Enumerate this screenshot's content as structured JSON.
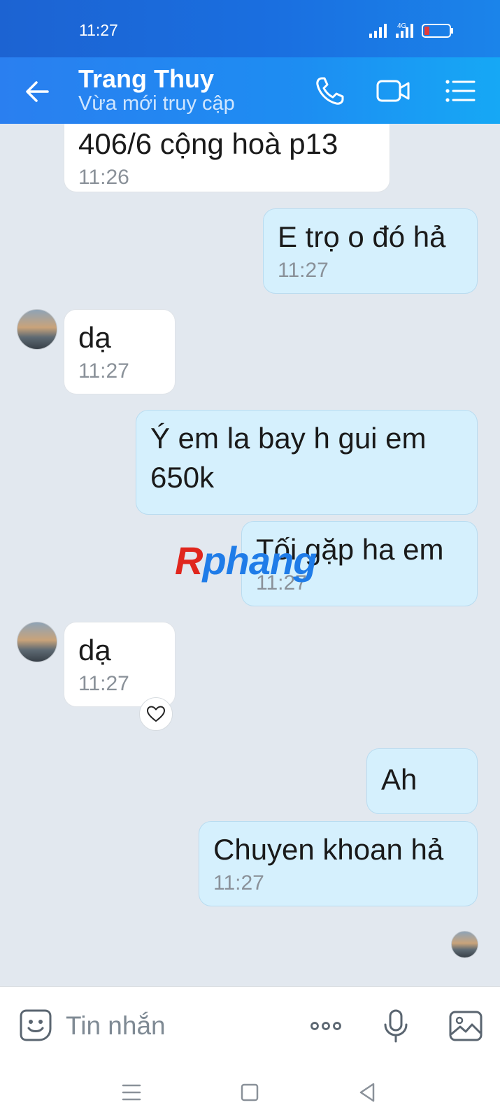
{
  "status_bar": {
    "time": "11:27",
    "network_label": "4G",
    "icons": [
      "signal-bars-icon",
      "network-4g-icon",
      "battery-low-icon"
    ]
  },
  "header": {
    "contact_name": "Trang Thuy",
    "contact_status": "Vừa mới truy cập",
    "icons": [
      "back-arrow-icon",
      "phone-call-icon",
      "video-call-icon",
      "menu-list-icon"
    ]
  },
  "messages": [
    {
      "side": "in",
      "text": "406/6 cộng hoà p13",
      "time": "11:26"
    },
    {
      "side": "out",
      "text": "E trọ o đó hả",
      "time": "11:27"
    },
    {
      "side": "in",
      "text": "dạ",
      "time": "11:27"
    },
    {
      "side": "out",
      "text_lines": [
        "Ý em la bay h gui em",
        "650k"
      ]
    },
    {
      "side": "out",
      "text": "Tối gặp ha em",
      "time": "11:27"
    },
    {
      "side": "in",
      "text": "dạ",
      "time": "11:27",
      "reaction_icon": "heart-outline-icon"
    },
    {
      "side": "out",
      "text": "Ah"
    },
    {
      "side": "out",
      "text": "Chuyen khoan hả",
      "time": "11:27"
    }
  ],
  "watermark": {
    "first_letter": "R",
    "rest": "phang"
  },
  "input_bar": {
    "placeholder": "Tin nhắn",
    "icons": [
      "emoji-sticker-icon",
      "more-dots-icon",
      "microphone-icon",
      "image-gallery-icon"
    ]
  },
  "nav_bar": {
    "icons": [
      "recent-apps-icon",
      "home-square-icon",
      "back-triangle-icon"
    ]
  },
  "colors": {
    "header_start": "#2a7ff0",
    "header_end": "#16a8f5",
    "chat_background": "#e2e8ef",
    "outgoing_bubble": "#d5f0fd",
    "incoming_bubble": "#ffffff",
    "time_text": "#8a9199",
    "battery_low": "#e23b3b"
  }
}
